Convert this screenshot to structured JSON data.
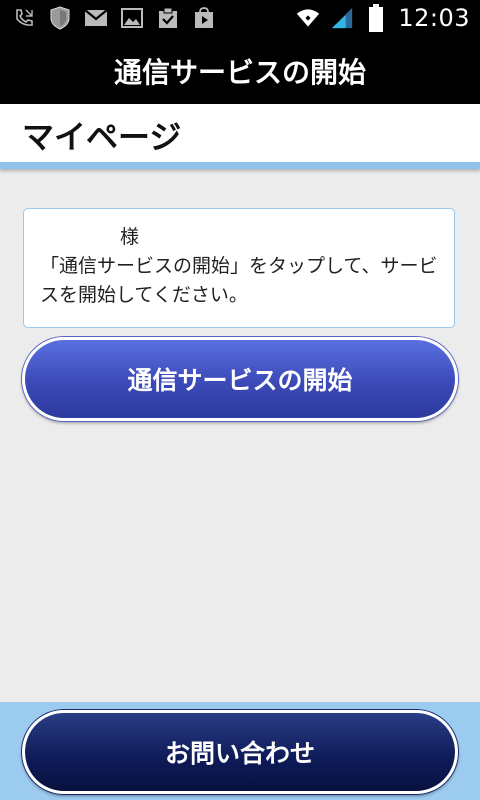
{
  "status_bar": {
    "time": "12:03",
    "icons": [
      "phone-missed-icon",
      "shield-icon",
      "gmail-icon",
      "image-icon",
      "task-check-icon",
      "play-store-icon",
      "wifi-icon",
      "signal-icon",
      "battery-icon"
    ]
  },
  "title_bar": {
    "title": "通信サービスの開始"
  },
  "page_header": {
    "title": "マイページ"
  },
  "message": {
    "name_line": "様",
    "body": "「通信サービスの開始」をタップして、サービスを開始してください。"
  },
  "buttons": {
    "start_service": "通信サービスの開始",
    "contact": "お問い合わせ"
  },
  "colors": {
    "title_bar": "#000000",
    "accent_rule": "#8fc2ea",
    "primary_button": "#3c4ab8",
    "contact_button": "#0e1a57",
    "bottom_panel": "#9ccbf0",
    "background": "#ececec"
  }
}
